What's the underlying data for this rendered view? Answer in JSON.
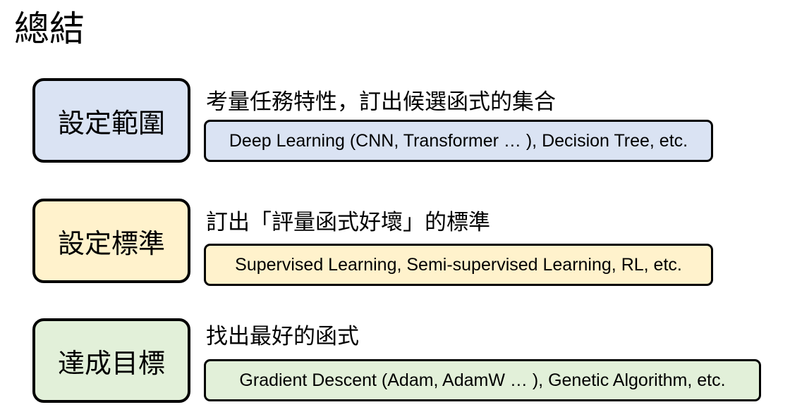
{
  "title": "總結",
  "colors": {
    "scope": "#dae3f3",
    "criterion": "#fff2cc",
    "optimize": "#e2f0d9",
    "border": "#000000"
  },
  "steps": [
    {
      "box_label": "設定範圍",
      "description": "考量任務特性，訂出候選函式的集合",
      "examples": "Deep Learning (CNN, Transformer … ), Decision Tree, etc."
    },
    {
      "box_label": "設定標準",
      "description": "訂出「評量函式好壞」的標準",
      "examples": "Supervised Learning, Semi-supervised Learning, RL, etc."
    },
    {
      "box_label": "達成目標",
      "description": "找出最好的函式",
      "examples": "Gradient Descent (Adam, AdamW … ), Genetic Algorithm, etc."
    }
  ]
}
